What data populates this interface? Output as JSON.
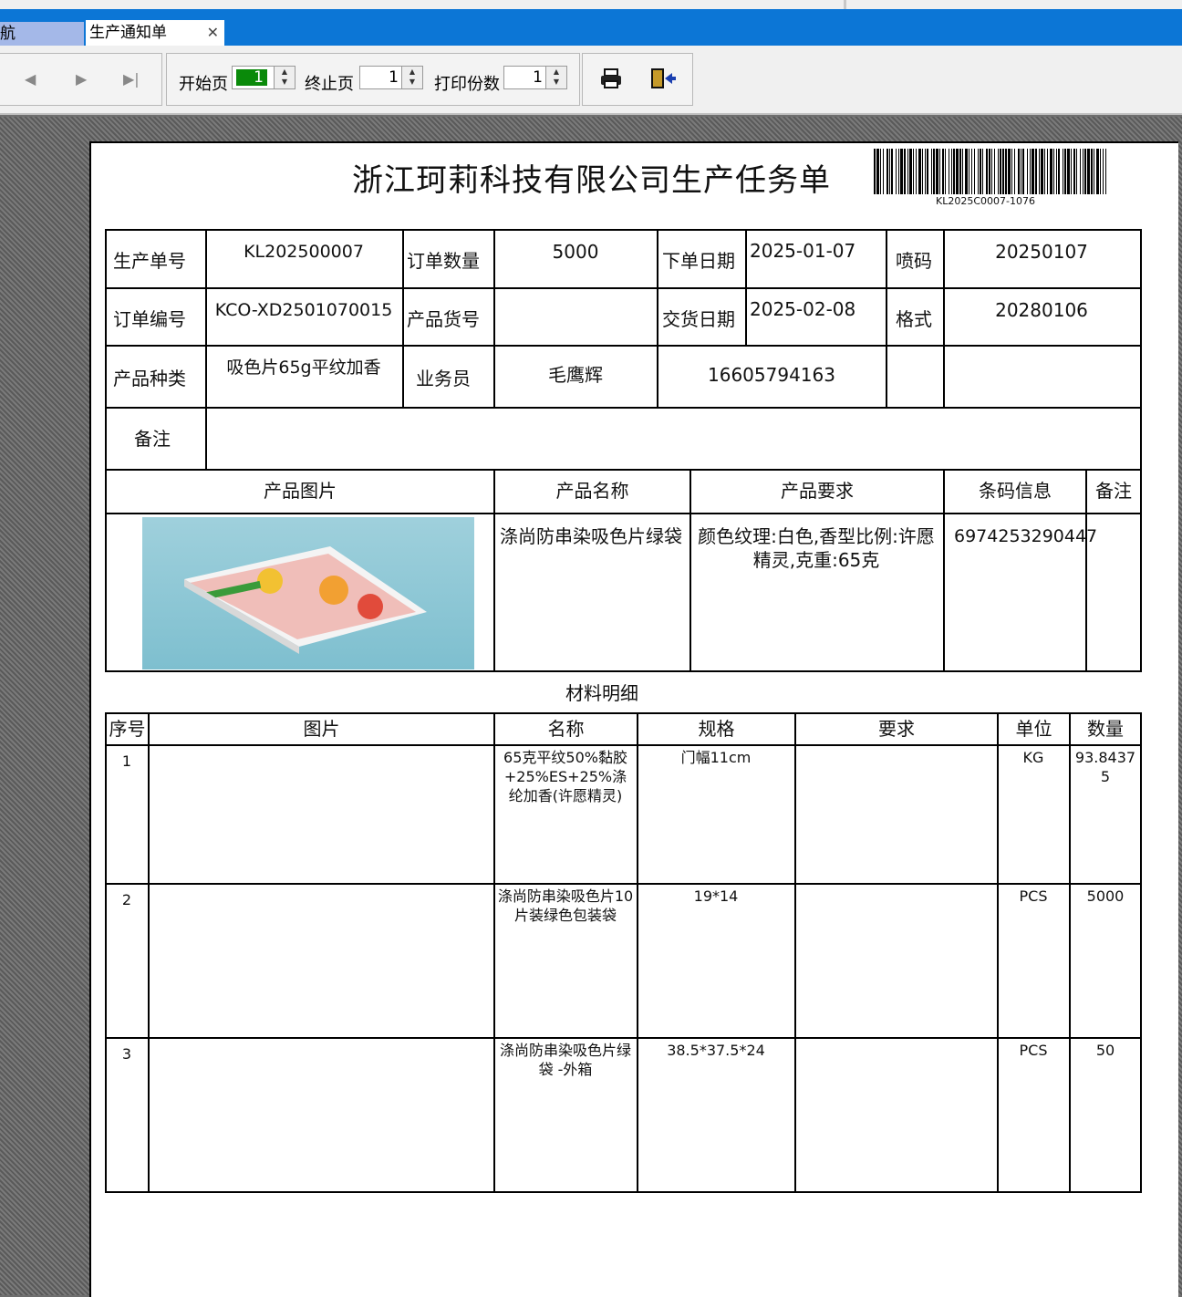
{
  "tabs": [
    {
      "label": "航"
    },
    {
      "label": "生产通知单"
    }
  ],
  "toolbar": {
    "start_page_label": "开始页",
    "start_page_value": "1",
    "end_page_label": "终止页",
    "end_page_value": "1",
    "copies_label": "打印份数",
    "copies_value": "1"
  },
  "doc": {
    "title": "浙江珂莉科技有限公司生产任务单",
    "barcode_text": "KL2025C0007-1076",
    "rows": [
      {
        "l1": "生产单号",
        "v1": "KL202500007",
        "l2": "订单数量",
        "v2": "5000",
        "l3": "下单日期",
        "v3": "2025-01-07",
        "l4": "喷码",
        "v4": "20250107"
      },
      {
        "l1": "订单编号",
        "v1": "KCO-XD2501070015",
        "l2": "产品货号",
        "v2": "",
        "l3": "交货日期",
        "v3": "2025-02-08",
        "l4": "格式",
        "v4": "20280106"
      },
      {
        "l1": "产品种类",
        "v1": "吸色片65g平纹加香",
        "l2": "业务员",
        "v2": "毛鹰辉",
        "v3": "16605794163"
      }
    ],
    "remark_label": "备注",
    "product_headers": [
      "产品图片",
      "产品名称",
      "产品要求",
      "条码信息",
      "备注"
    ],
    "product": {
      "name": "涤尚防串染吸色片绿袋",
      "requirement": "颜色纹理:白色,香型比例:许愿精灵,克重:65克",
      "barcode": "6974253290447"
    },
    "materials_title": "材料明细",
    "material_headers": [
      "序号",
      "图片",
      "名称",
      "规格",
      "要求",
      "单位",
      "数量"
    ],
    "materials": [
      {
        "no": "1",
        "name": "65克平纹50%黏胶+25%ES+25%涤纶加香(许愿精灵)",
        "spec": "门幅11cm",
        "unit": "KG",
        "qty": "93.84375"
      },
      {
        "no": "2",
        "name": "涤尚防串染吸色片10片装绿色包装袋",
        "spec": "19*14",
        "unit": "PCS",
        "qty": "5000"
      },
      {
        "no": "3",
        "name": "涤尚防串染吸色片绿袋 -外箱",
        "spec": "38.5*37.5*24",
        "unit": "PCS",
        "qty": "50"
      }
    ]
  }
}
